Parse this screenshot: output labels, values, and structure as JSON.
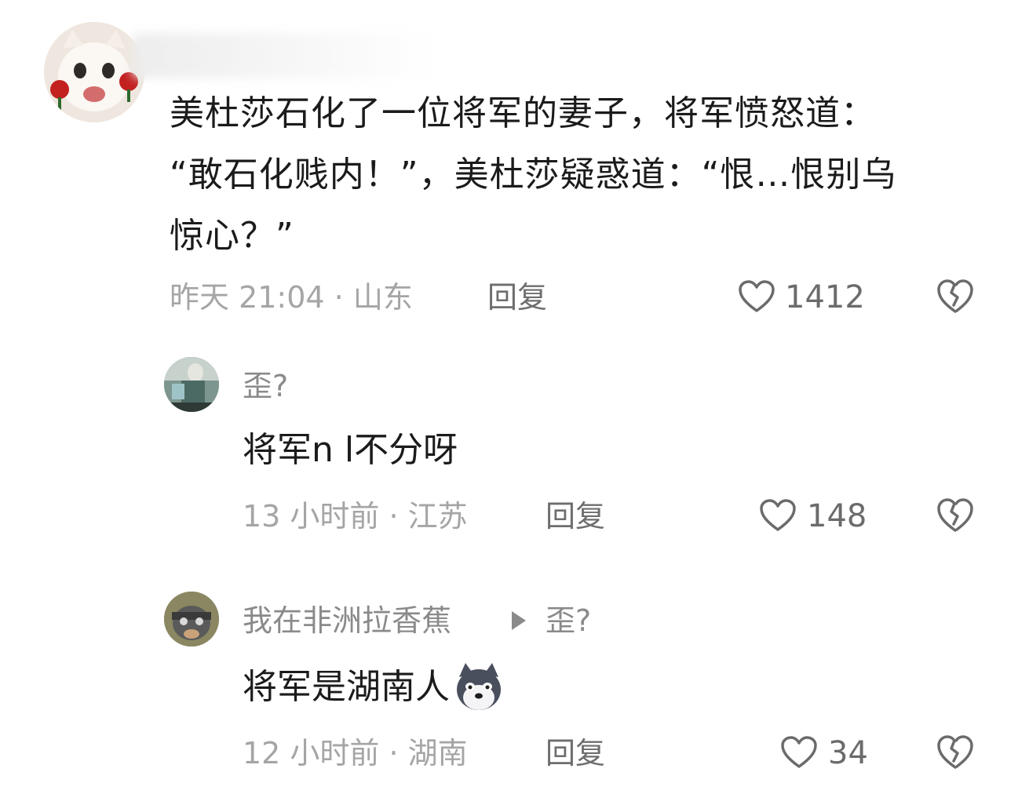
{
  "comment": {
    "text_line1": "美杜莎石化了一位将军的妻子，将军愤怒道：",
    "text_line2": "“敢石化贱内！”，美杜莎疑惑道：“恨…恨别乌",
    "text_line3": "惊心？”",
    "time_location": "昨天 21:04 · 山东",
    "reply_label": "回复",
    "likes": "1412"
  },
  "replies": [
    {
      "username": "歪?",
      "text": "将军n l不分呀",
      "time_location": "13 小时前 · 江苏",
      "reply_label": "回复",
      "likes": "148"
    },
    {
      "username": "我在非洲拉香蕉",
      "reply_to": "歪?",
      "text": "将军是湖南人",
      "time_location": "12 小时前 · 湖南",
      "reply_label": "回复",
      "likes": "34"
    }
  ],
  "icons": {
    "like": "heart-outline-icon",
    "dislike": "broken-heart-icon",
    "reply_to_arrow": "triangle-right-icon"
  },
  "colors": {
    "text": "#1b1b1b",
    "meta": "#a5a5a5",
    "username": "#8a8a8a"
  }
}
